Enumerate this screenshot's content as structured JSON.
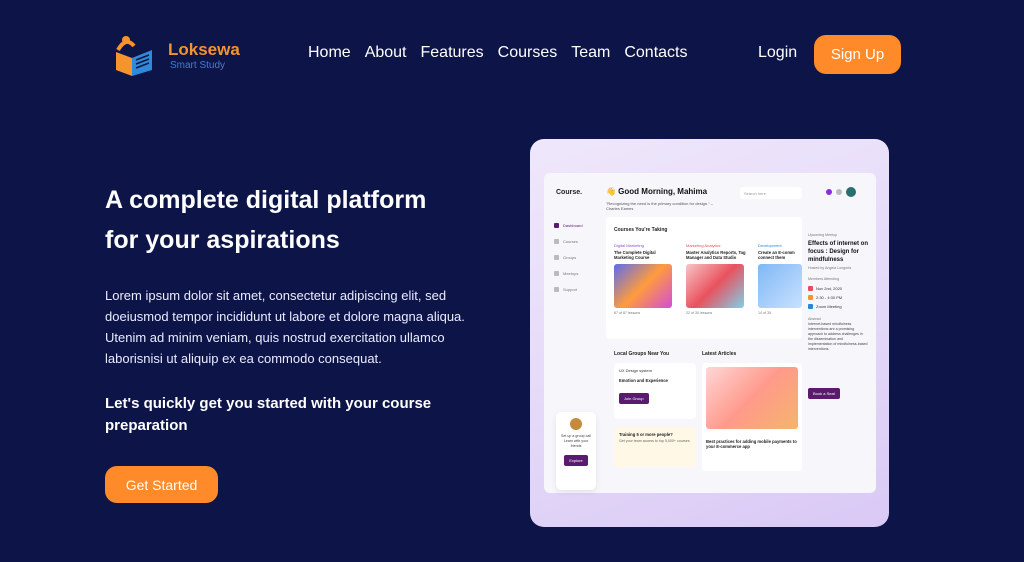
{
  "brand": {
    "name": "Loksewa",
    "tagline": "Smart Study"
  },
  "nav": {
    "links": [
      "Home",
      "About",
      "Features",
      "Courses",
      "Team",
      "Contacts"
    ],
    "login": "Login",
    "signup": "Sign Up"
  },
  "hero": {
    "title_line1": "A complete digital platform",
    "title_line2": "for your aspirations",
    "description": "Lorem ipsum dolor sit amet, consectetur adipiscing elit, sed doeiusmod tempor incididunt ut labore et dolore magna aliqua. Utenim ad minim veniam, quis nostrud exercitation ullamco laborisnisi ut aliquip ex ea commodo consequat.",
    "subheading": "Let's quickly get you started with your course preparation",
    "cta": "Get Started"
  },
  "mockup": {
    "brand": "Course.",
    "greeting": "👋 Good Morning, Mahima",
    "quote": "\"Recognizing the need is the primary condition for design.\" – Charles Eames",
    "search_placeholder": "Search here",
    "sidebar": [
      "Dashboard",
      "Courses",
      "Groups",
      "Meetups",
      "Support"
    ],
    "courses_heading": "Courses You're Taking",
    "courses": [
      {
        "category": "Digital Marketing",
        "name": "The Complete Digital Marketing Course",
        "meta": "87 of 87 lessons"
      },
      {
        "category": "Marketing Analytics",
        "name": "Master Analytics Reports, Tag Manager and Data Studio",
        "meta": "22 of 30 lessons"
      },
      {
        "category": "Development",
        "name": "Create an E-comm connect them",
        "meta": "14 of 35"
      }
    ],
    "local_groups_heading": "Local Groups Near You",
    "group_name": "UX Design system",
    "group_sub": "Emotion and Experience",
    "join": "Join Group",
    "articles_heading": "Latest Articles",
    "article_title": "Best practices for adding mobile payments to your E-commerce app",
    "training": "Training 5 or more people?",
    "training_sub": "Get your team access to top 5,000+ courses",
    "float_text": "Set up a group call Learn with your friends",
    "float_btn": "Explore",
    "upcoming_label": "Upcoming Meetup",
    "upcoming_title": "Effects of internet on focus : Design for mindfulness",
    "hosted": "Hosted by Angela Longoria",
    "members": "Members Attending",
    "date": "Nov 2nd, 2020",
    "time": "2:30 - 4:30 PM",
    "venue": "Zoom Meeting",
    "abstract_label": "Abstract",
    "abstract": "Internet-based mindfulness interventions are a promising approach to address challenges in the dissemination and implementation of mindfulness-based interventions.",
    "book": "Book a Seat"
  }
}
